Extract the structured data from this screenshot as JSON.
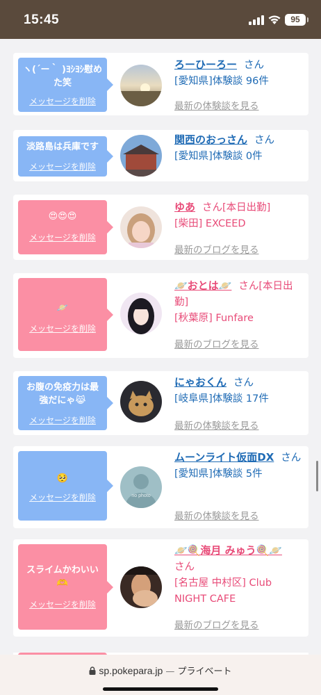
{
  "status_bar": {
    "time": "15:45",
    "battery": "95"
  },
  "colors": {
    "blue_bubble": "#88b6f5",
    "pink_bubble": "#fb8fa4",
    "blue_text": "#1f6bb5",
    "pink_text": "#e84b78"
  },
  "items": [
    {
      "message": "ヽ(´ー｀ )ﾖｼﾖｼ慰めた笑",
      "delete_label": "メッセージを削除",
      "name": "ろーひーろー",
      "suffix": "さん",
      "detail": "[愛知県]体験談 96件",
      "more": "最新の体験談を見る"
    },
    {
      "message": "淡路島は兵庫です",
      "delete_label": "メッセージを削除",
      "name": "関西のおっさん",
      "suffix": "さん",
      "detail": "[愛知県]体験談 0件",
      "more": "最新の体験談を見る"
    },
    {
      "message": "😍😍😍",
      "delete_label": "メッセージを削除",
      "name": "ゆあ",
      "suffix": "さん[本日出勤]",
      "detail": "[柴田] EXCEED",
      "more": "最新のブログを見る"
    },
    {
      "message": "🪐",
      "delete_label": "メッセージを削除",
      "name": "🪐おとは🪐",
      "suffix": "さん[本日出勤]",
      "detail": "[秋葉原] Funfare",
      "more": "最新のブログを見る"
    },
    {
      "message": "お腹の免疫力は最強だにゃ😹",
      "delete_label": "メッセージを削除",
      "name": "にゃおくん",
      "suffix": "さん",
      "detail": "[岐阜県]体験談 17件",
      "more": "最新の体験談を見る"
    },
    {
      "message": "🥺",
      "delete_label": "メッセージを削除",
      "name": "ムーンライト仮面DX",
      "suffix": "さん",
      "detail": "[愛知県]体験談 5件",
      "more": "最新の体験談を見る",
      "avatar_text": "no photo"
    },
    {
      "message": "スライムかわいい🫶",
      "delete_label": "メッセージを削除",
      "name": "🪐🍭海月 みゅう🍭🪐",
      "suffix": "さん",
      "detail": "[名古屋 中村区] Club NIGHT CAFE",
      "more": "最新のブログを見る"
    }
  ],
  "browser": {
    "domain": "sp.pokepara.jp",
    "separator": "—",
    "mode": "プライベート"
  }
}
